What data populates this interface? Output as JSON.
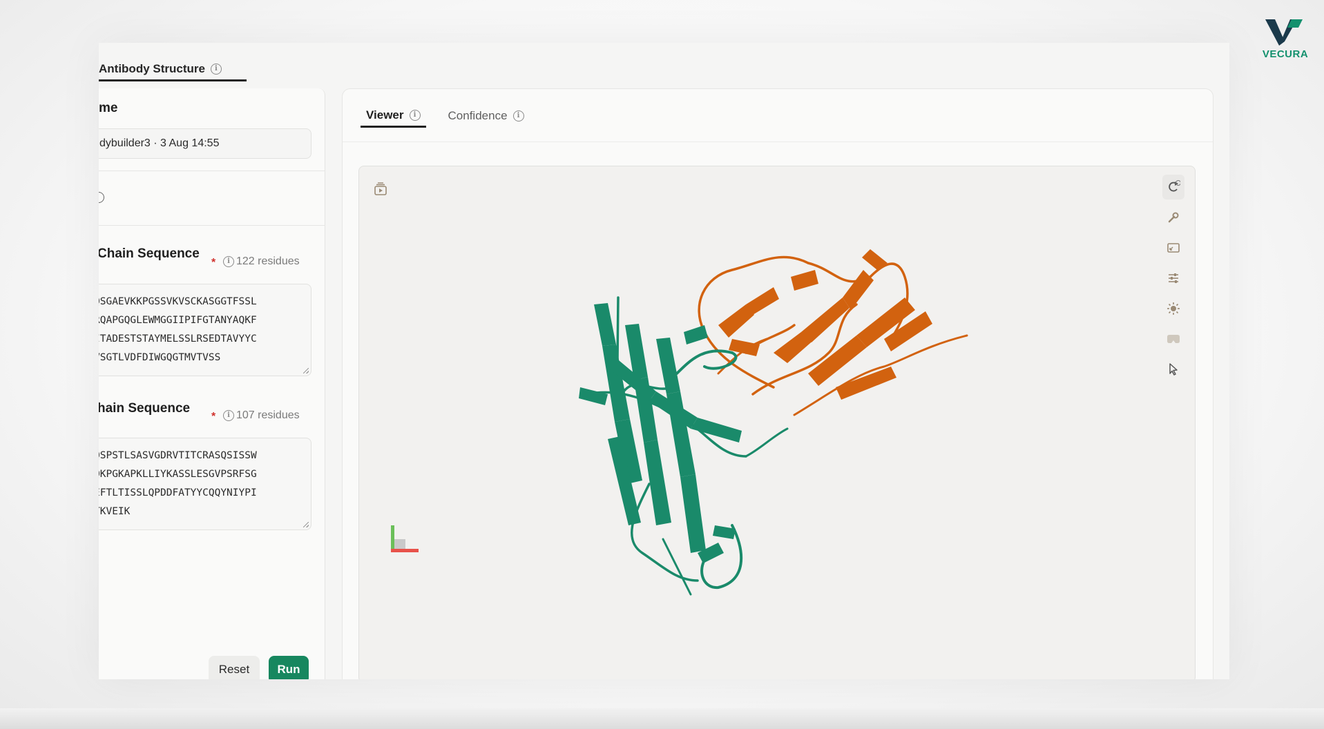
{
  "brand": {
    "name": "VECURA",
    "accent": "#14916e",
    "accent2": "#1b3a4b"
  },
  "top_tab": {
    "label": "Antibody Structure"
  },
  "form": {
    "name_label": "me",
    "name_value": "dybuilder3 · 3 Aug 14:55",
    "heavy_label": "Chain Sequence",
    "heavy_residues": "122 residues",
    "heavy_lines": [
      "QSGAEVKKPGSSVKVSCKASGGTFSSL",
      "RQAPGQGLEWMGGIIPIFGTANYAQKF",
      "ITADESTSTAYMELSSLRSEDTAVYYC",
      "VSGTLVDFDIWGQGTMVTVSS"
    ],
    "light_label": "hain Sequence",
    "light_residues": "107 residues",
    "light_lines": [
      "QSPSTLSASVGDRVTITCRASQSISSW",
      "QKPGKAPKLLIYKASSLESGVPSRFSG",
      "EFTLTISSLQPDDFATYYCQQYNIYPI",
      "TKVEIK"
    ],
    "required_mark": "*",
    "reset_label": "Reset",
    "run_label": "Run"
  },
  "viewer": {
    "tabs": [
      {
        "label": "Viewer",
        "active": true
      },
      {
        "label": "Confidence",
        "active": false
      }
    ],
    "toolbar_icons": [
      "refresh-icon",
      "wrench-icon",
      "screenshot-icon",
      "sliders-icon",
      "lighting-icon",
      "vr-icon",
      "select-cursor-icon"
    ],
    "chain_colors": {
      "heavy": "#1a8a6a",
      "light": "#d2620f"
    }
  }
}
